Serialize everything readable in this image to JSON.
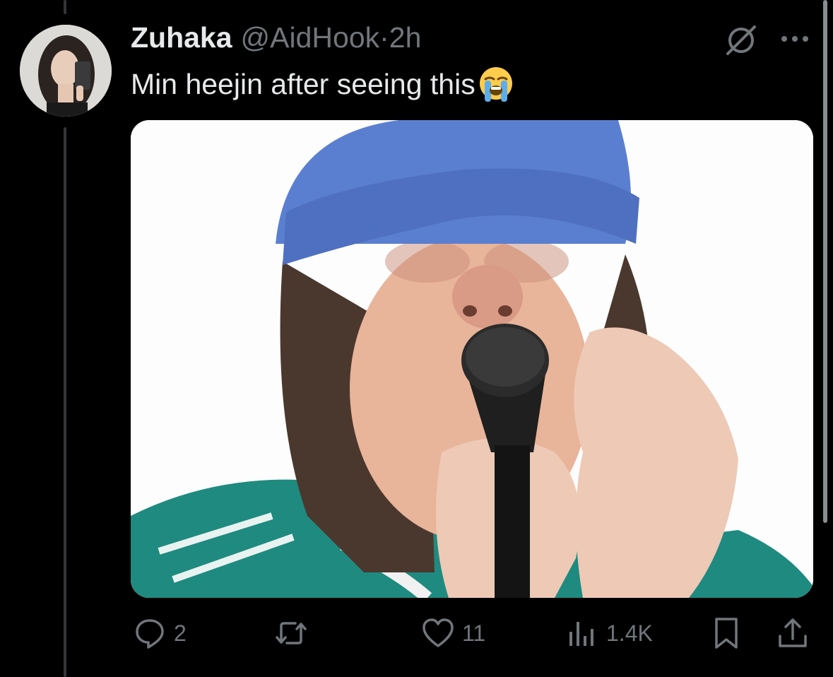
{
  "tweet": {
    "display_name": "Zuhaka",
    "handle": "@AidHook",
    "separator": "·",
    "time": "2h",
    "text": "Min heejin after seeing this",
    "emoji": "loudly-crying-face"
  },
  "header_icons": [
    "grok-icon",
    "more-icon"
  ],
  "media": {
    "kind": "photo",
    "accent_colors": {
      "cap": "#5b7fd0",
      "shirt": "#1f8a7f"
    }
  },
  "actions": {
    "reply": {
      "icon": "reply-icon",
      "count": "2"
    },
    "retweet": {
      "icon": "retweet-icon",
      "count": ""
    },
    "like": {
      "icon": "heart-icon",
      "count": "11"
    },
    "views": {
      "icon": "views-icon",
      "count": "1.4K"
    },
    "bookmark": {
      "icon": "bookmark-icon"
    },
    "share": {
      "icon": "share-icon"
    }
  },
  "colors": {
    "background": "#000000",
    "text": "#e7e9ea",
    "muted": "#71767b",
    "thread_line": "#333639"
  }
}
